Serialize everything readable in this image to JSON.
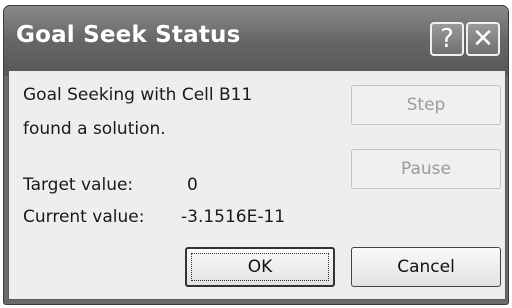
{
  "dialog": {
    "title": "Goal Seek Status",
    "help_icon": "question-mark-icon",
    "close_icon": "close-x-icon",
    "help_glyph": "?",
    "close_glyph": "✕",
    "message_line1": "Goal Seeking with Cell B11",
    "message_line2": "found a solution.",
    "target_label": "Target value:",
    "target_value": "0",
    "current_label": "Current value:",
    "current_value": "-3.1516E-11",
    "buttons": {
      "step": "Step",
      "pause": "Pause",
      "ok": "OK",
      "cancel": "Cancel"
    }
  }
}
